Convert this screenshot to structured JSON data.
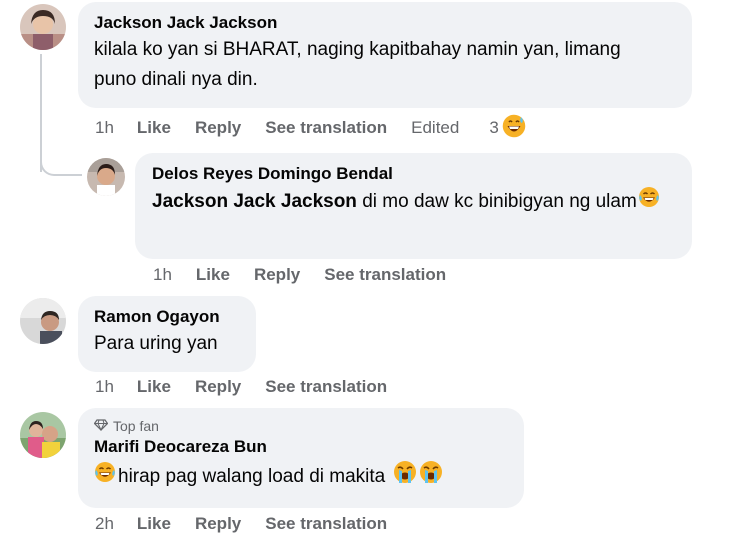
{
  "comments": [
    {
      "author": "Jackson Jack Jackson",
      "text": "kilala ko yan si BHARAT, naging kapitbahay namin yan, limang puno dinali nya din.",
      "time": "1h",
      "like": "Like",
      "reply": "Reply",
      "see_translation": "See translation",
      "edited": "Edited",
      "reaction_count": "3",
      "reaction_icon": "grinning-sweat-emoji",
      "replies": [
        {
          "author": "Delos Reyes Domingo Bendal",
          "mention": "Jackson Jack Jackson",
          "text": " di mo daw kc binibigyan ng ulam",
          "text_emoji": "crying-laughing-emoji",
          "time": "1h",
          "like": "Like",
          "reply": "Reply",
          "see_translation": "See translation"
        }
      ]
    },
    {
      "author": "Ramon Ogayon",
      "text": "Para uring yan",
      "time": "1h",
      "like": "Like",
      "reply": "Reply",
      "see_translation": "See translation"
    },
    {
      "badge": "Top fan",
      "badge_icon": "diamond-icon",
      "author": "Marifi Deocareza Bun",
      "text": "hirap pag walang load di makita",
      "text_emojis": [
        "crying-laughing-emoji",
        "loudly-crying-emoji",
        "loudly-crying-emoji"
      ],
      "time": "2h",
      "like": "Like",
      "reply": "Reply",
      "see_translation": "See translation"
    }
  ],
  "colors": {
    "bubble": "#f0f2f5",
    "secondary_text": "#65676b",
    "primary_text": "#050505"
  }
}
